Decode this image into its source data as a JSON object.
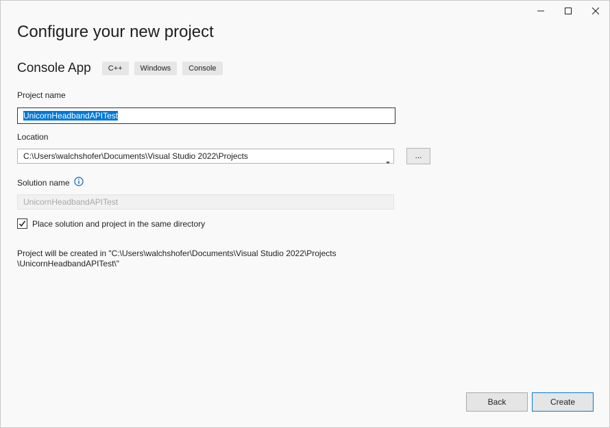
{
  "window": {
    "controls": {
      "minimize_icon": "minimize-icon",
      "maximize_icon": "maximize-icon",
      "close_icon": "close-icon"
    }
  },
  "header": {
    "title": "Configure your new project",
    "template_name": "Console App",
    "tags": [
      "C++",
      "Windows",
      "Console"
    ]
  },
  "form": {
    "project_name_label": "Project name",
    "project_name_value": "UnicornHeadbandAPITest",
    "location_label": "Location",
    "location_value": "C:\\Users\\walchshofer\\Documents\\Visual Studio 2022\\Projects",
    "browse_label": "...",
    "solution_name_label": "Solution name",
    "solution_name_placeholder": "UnicornHeadbandAPITest",
    "same_directory_label": "Place solution and project in the same directory",
    "same_directory_checked": true,
    "path_info_line1": "Project will be created in \"C:\\Users\\walchshofer\\Documents\\Visual Studio 2022\\Projects",
    "path_info_line2": "\\UnicornHeadbandAPITest\\\""
  },
  "footer": {
    "back_label": "Back",
    "create_label": "Create"
  },
  "colors": {
    "accent": "#0078d7",
    "background": "#f9f9f9"
  }
}
